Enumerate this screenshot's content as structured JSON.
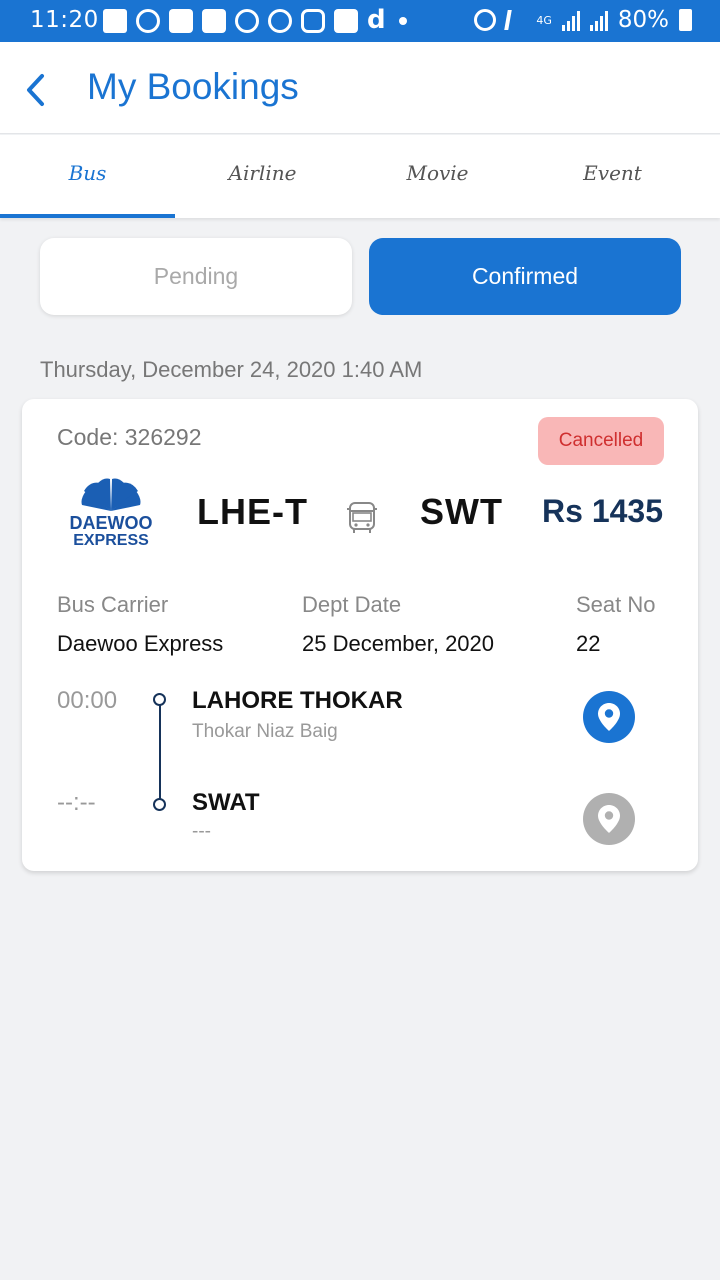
{
  "status_bar": {
    "time": "11:20",
    "network": "4G",
    "battery": "80%",
    "notification_icons": [
      "message-icon",
      "sync-icon",
      "facebook-icon",
      "facebook-icon",
      "sync-icon",
      "sync-icon",
      "instagram-icon",
      "facebook-icon",
      "dailymotion-icon"
    ]
  },
  "header": {
    "title": "My Bookings",
    "back_icon": "chevron-left-icon"
  },
  "tabs": [
    {
      "label": "Bus",
      "active": true
    },
    {
      "label": "Airline",
      "active": false
    },
    {
      "label": "Movie",
      "active": false
    },
    {
      "label": "Event",
      "active": false
    }
  ],
  "filter": {
    "pending_label": "Pending",
    "confirmed_label": "Confirmed",
    "selected": "Confirmed"
  },
  "booking_date": "Thursday, December 24, 2020 1:40 AM",
  "booking": {
    "code": "Code: 326292",
    "status": "Cancelled",
    "carrier_logo": {
      "line1": "DAEWOO",
      "line2": "EXPRESS"
    },
    "origin": "LHE-T",
    "destination": "SWT",
    "transport_icon": "bus-icon",
    "price": "Rs 1435",
    "details": {
      "carrier_label": "Bus Carrier",
      "carrier_value": "Daewoo Express",
      "date_label": "Dept Date",
      "date_value": "25 December, 2020",
      "seat_label": "Seat No",
      "seat_value": "22"
    },
    "stops": [
      {
        "time": "00:00",
        "name": "LAHORE THOKAR",
        "sub": "Thokar Niaz Baig",
        "icon": "map-pin-icon"
      },
      {
        "time": "--:--",
        "name": "SWAT",
        "sub": "---",
        "icon": "map-pin-icon"
      }
    ]
  },
  "colors": {
    "primary": "#1a74d2",
    "price": "#16335a",
    "cancelled_bg": "#f9b7b7",
    "cancelled_text": "#cf2f2f",
    "background": "#f1f2f4"
  }
}
